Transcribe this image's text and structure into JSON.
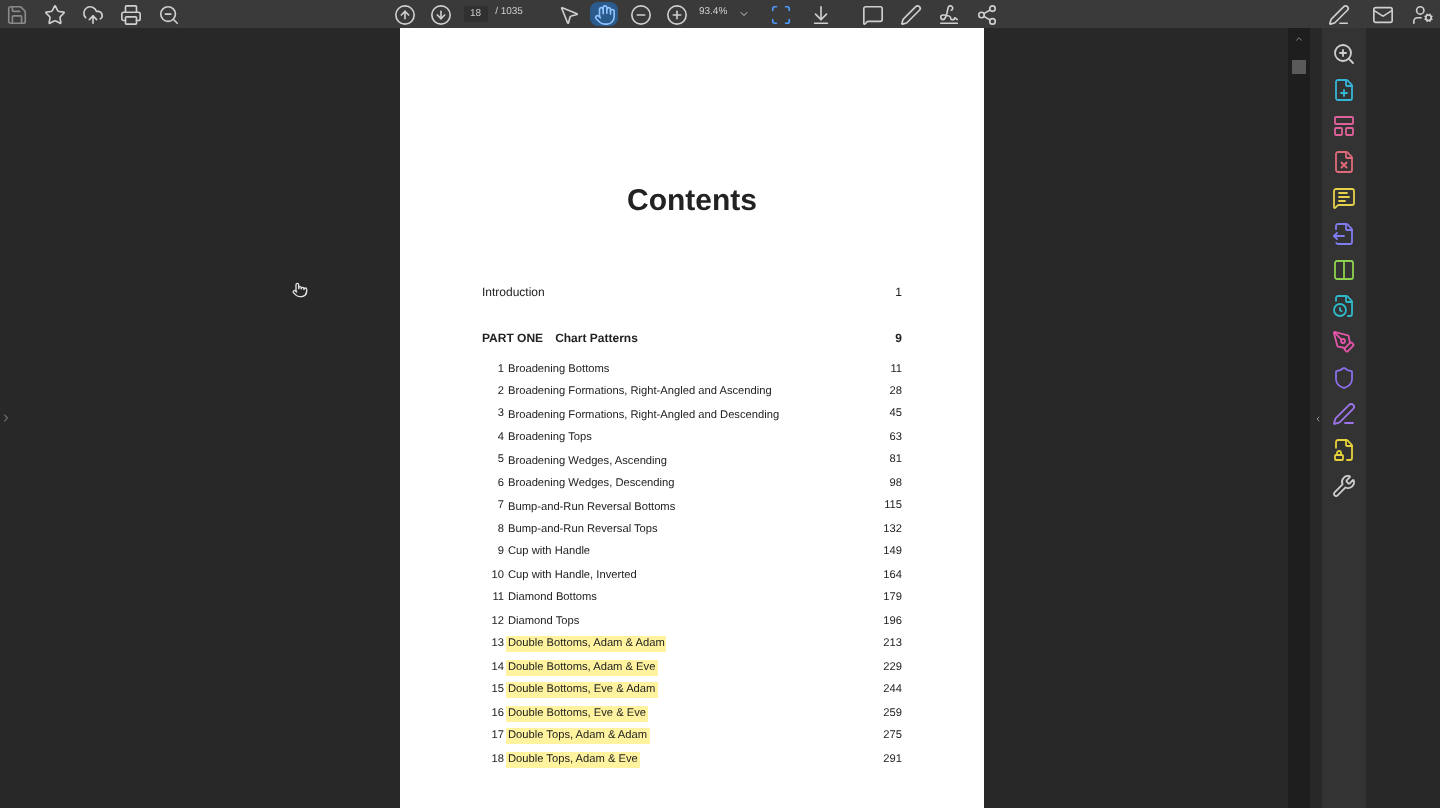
{
  "toolbar": {
    "page_current": "18",
    "page_total": "/ 1035",
    "zoom": "93.4%",
    "tools": [
      {
        "kind": "select",
        "selected": false
      },
      {
        "kind": "hand",
        "selected": true
      }
    ]
  },
  "document": {
    "title": "Contents",
    "intro": {
      "title": "Introduction",
      "page": "1"
    },
    "part": {
      "label": "PART ONE",
      "title": "Chart Patterns",
      "page": "9"
    },
    "chapters": [
      {
        "number": "1",
        "title": "Broadening Bottoms",
        "page": "11",
        "highlighted": false
      },
      {
        "number": "2",
        "title": "Broadening Formations, Right-Angled and Ascending",
        "page": "28",
        "highlighted": false
      },
      {
        "number": "3",
        "title": "Broadening Formations, Right-Angled and Descending",
        "page": "45",
        "highlighted": false
      },
      {
        "number": "4",
        "title": "Broadening Tops",
        "page": "63",
        "highlighted": false
      },
      {
        "number": "5",
        "title": "Broadening Wedges, Ascending",
        "page": "81",
        "highlighted": false
      },
      {
        "number": "6",
        "title": "Broadening Wedges, Descending",
        "page": "98",
        "highlighted": false
      },
      {
        "number": "7",
        "title": "Bump-and-Run Reversal Bottoms",
        "page": "115",
        "highlighted": false
      },
      {
        "number": "8",
        "title": "Bump-and-Run Reversal Tops",
        "page": "132",
        "highlighted": false
      },
      {
        "number": "9",
        "title": "Cup with Handle",
        "page": "149",
        "highlighted": false
      },
      {
        "number": "10",
        "title": "Cup with Handle, Inverted",
        "page": "164",
        "highlighted": false
      },
      {
        "number": "11",
        "title": "Diamond Bottoms",
        "page": "179",
        "highlighted": false
      },
      {
        "number": "12",
        "title": "Diamond Tops",
        "page": "196",
        "highlighted": false
      },
      {
        "number": "13",
        "title": "Double Bottoms, Adam & Adam",
        "page": "213",
        "highlighted": true
      },
      {
        "number": "14",
        "title": "Double Bottoms, Adam & Eve",
        "page": "229",
        "highlighted": true
      },
      {
        "number": "15",
        "title": "Double Bottoms, Eve & Adam",
        "page": "244",
        "highlighted": true
      },
      {
        "number": "16",
        "title": "Double Bottoms, Eve & Eve",
        "page": "259",
        "highlighted": true
      },
      {
        "number": "17",
        "title": "Double Tops, Adam & Adam",
        "page": "275",
        "highlighted": true
      },
      {
        "number": "18",
        "title": "Double Tops, Adam & Eve",
        "page": "291",
        "highlighted": true
      }
    ]
  }
}
